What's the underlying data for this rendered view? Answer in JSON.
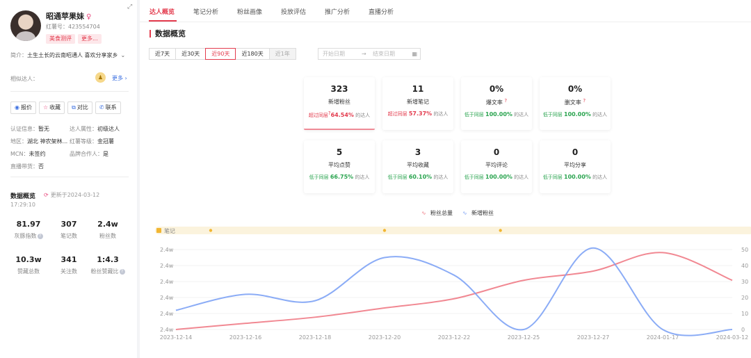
{
  "profile": {
    "name": "昭通苹果妹",
    "gender_icon": "♀",
    "red_id_label": "红薯号：",
    "red_id": "423554704",
    "tags": [
      "美食测评",
      "更多..."
    ],
    "intro_label": "简介：",
    "intro": "土生土长的云南昭通人 喜欢分享家乡",
    "similar_label": "相似达人：",
    "more_label": "更多",
    "actions": [
      "报价",
      "收藏",
      "对比",
      "联系"
    ],
    "info": {
      "auth_k": "认证信息：",
      "auth_v": "暂无",
      "attr_k": "达人属性：",
      "attr_v": "初级达人",
      "region_k": "地区：",
      "region_v": "湖北 神农架林...",
      "level_k": "红薯等级：",
      "level_v": "金冠薯",
      "mcn_k": "MCN：",
      "mcn_v": "未签约",
      "brand_k": "品牌合作人：",
      "brand_v": "是",
      "live_k": "直播带货：",
      "live_v": "否"
    },
    "data_overview": {
      "title": "数据概览",
      "update_label": "更新于2024-03-12",
      "update_time": "17:29:10",
      "stats": [
        {
          "value": "81.97",
          "label": "灰豚指数"
        },
        {
          "value": "307",
          "label": "笔记数"
        },
        {
          "value": "2.4w",
          "label": "粉丝数"
        },
        {
          "value": "10.3w",
          "label": "赞藏总数"
        },
        {
          "value": "341",
          "label": "关注数"
        },
        {
          "value": "1:4.3",
          "label": "粉丝赞藏比"
        }
      ]
    }
  },
  "tabs": [
    "达人概览",
    "笔记分析",
    "粉丝画像",
    "投放评估",
    "推广分析",
    "直播分析"
  ],
  "section_title": "数据概览",
  "periods": [
    "近7天",
    "近30天",
    "近90天",
    "近180天",
    "近1年"
  ],
  "active_period": "近90天",
  "date_range": {
    "start_placeholder": "开始日期",
    "arrow": "→",
    "end_placeholder": "结束日期"
  },
  "cards": [
    {
      "value": "323",
      "label": "新增粉丝",
      "prefix": "超过同层",
      "pct": "64.54%",
      "suffix": "的达人",
      "tone": "red"
    },
    {
      "value": "11",
      "label": "新增笔记",
      "prefix": "超过同层",
      "pct": "57.37%",
      "suffix": "的达人",
      "tone": "red"
    },
    {
      "value": "0%",
      "label": "爆文率",
      "prefix": "低于同层",
      "pct": "100.00%",
      "suffix": "的达人",
      "tone": "green"
    },
    {
      "value": "0%",
      "label": "删文率",
      "prefix": "低于同层",
      "pct": "100.00%",
      "suffix": "的达人",
      "tone": "green"
    },
    {
      "value": "5",
      "label": "平均点赞",
      "prefix": "低于同层",
      "pct": "66.75%",
      "suffix": "的达人",
      "tone": "green"
    },
    {
      "value": "3",
      "label": "平均收藏",
      "prefix": "低于同层",
      "pct": "60.10%",
      "suffix": "的达人",
      "tone": "green"
    },
    {
      "value": "0",
      "label": "平均评论",
      "prefix": "低于同层",
      "pct": "100.00%",
      "suffix": "的达人",
      "tone": "green"
    },
    {
      "value": "0",
      "label": "平均分享",
      "prefix": "低于同层",
      "pct": "100.00%",
      "suffix": "的达人",
      "tone": "green"
    }
  ],
  "colors": {
    "accent": "#e33b4d",
    "total_fans": "#f07b86",
    "new_fans": "#7ea3f5",
    "note_band": "#fbf3dd",
    "note_dot": "#f2b632"
  },
  "chart_data": {
    "type": "line",
    "x": [
      "2023-12-14",
      "2023-12-16",
      "2023-12-18",
      "2023-12-20",
      "2023-12-22",
      "2023-12-25",
      "2023-12-27",
      "2024-01-17",
      "2024-03-12"
    ],
    "series": [
      {
        "name": "粉丝总量",
        "axis": "left",
        "values": [
          0,
          0.2,
          0.4,
          0.7,
          1.0,
          1.6,
          1.9,
          2.5,
          1.6
        ]
      },
      {
        "name": "新增粉丝",
        "axis": "right",
        "values": [
          12,
          22,
          18,
          45,
          34,
          0,
          51,
          0,
          0
        ]
      }
    ],
    "note_label": "笔记",
    "note_x": [
      "2023-12-15",
      "2023-12-20",
      "2023-12-24"
    ],
    "left_ticks": [
      "2.4w",
      "2.4w",
      "2.4w",
      "2.4w",
      "2.4w",
      "2.4w"
    ],
    "right_ticks": [
      "0",
      "10",
      "20",
      "30",
      "40",
      "50"
    ],
    "ylim_right": [
      0,
      50
    ],
    "grid": true,
    "legend_position": "top-center"
  }
}
